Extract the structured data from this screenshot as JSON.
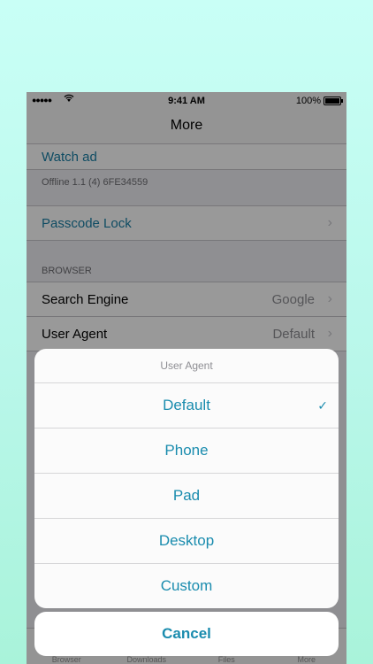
{
  "status_bar": {
    "signal": "●●●●●",
    "time": "9:41 AM",
    "battery": "100%"
  },
  "nav": {
    "title": "More"
  },
  "settings": {
    "watch_ad": "Watch ad",
    "version": "Offline 1.1 (4) 6FE34559",
    "passcode": "Passcode Lock",
    "browser_header": "BROWSER",
    "search_engine_label": "Search Engine",
    "search_engine_value": "Google",
    "user_agent_label": "User Agent",
    "user_agent_value": "Default",
    "chevron": "›"
  },
  "tabs": [
    {
      "label": "Browser"
    },
    {
      "label": "Downloads"
    },
    {
      "label": "Files"
    },
    {
      "label": "More"
    }
  ],
  "action_sheet": {
    "title": "User Agent",
    "options": [
      {
        "label": "Default",
        "selected": true
      },
      {
        "label": "Phone",
        "selected": false
      },
      {
        "label": "Pad",
        "selected": false
      },
      {
        "label": "Desktop",
        "selected": false
      },
      {
        "label": "Custom",
        "selected": false
      }
    ],
    "check": "✓",
    "cancel": "Cancel"
  },
  "colors": {
    "accent": "#1a8cae",
    "background_top": "#c9fff6",
    "background_bottom": "#a9f3da"
  }
}
